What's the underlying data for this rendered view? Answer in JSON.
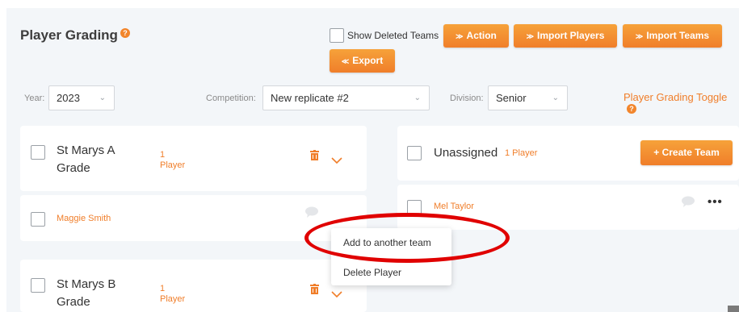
{
  "header": {
    "title": "Player Grading",
    "show_deleted_label": "Show Deleted Teams",
    "action_label": "Action",
    "import_players_label": "Import Players",
    "import_teams_label": "Import Teams",
    "export_label": "Export"
  },
  "filters": {
    "year_label": "Year:",
    "year_value": "2023",
    "competition_label": "Competition:",
    "competition_value": "New replicate #2",
    "division_label": "Division:",
    "division_value": "Senior",
    "grading_toggle_label": "Player Grading Toggle"
  },
  "teams": [
    {
      "name_line1": "St Marys A",
      "name_line2": "Grade",
      "count_line1": "1",
      "count_line2": "Player"
    },
    {
      "name_line1": "St Marys B",
      "name_line2": "Grade",
      "count_line1": "1",
      "count_line2": "Player"
    }
  ],
  "team_players": [
    "Maggie Smith"
  ],
  "unassigned": {
    "title": "Unassigned",
    "count": "1 Player",
    "create_label": "+ Create Team",
    "players": [
      "Mel Taylor"
    ]
  },
  "menu": {
    "add_to_team": "Add to another team",
    "delete_player": "Delete Player"
  },
  "colors": {
    "accent": "#f07e2a",
    "annotation": "#e00000",
    "background": "#f3f6f9"
  }
}
